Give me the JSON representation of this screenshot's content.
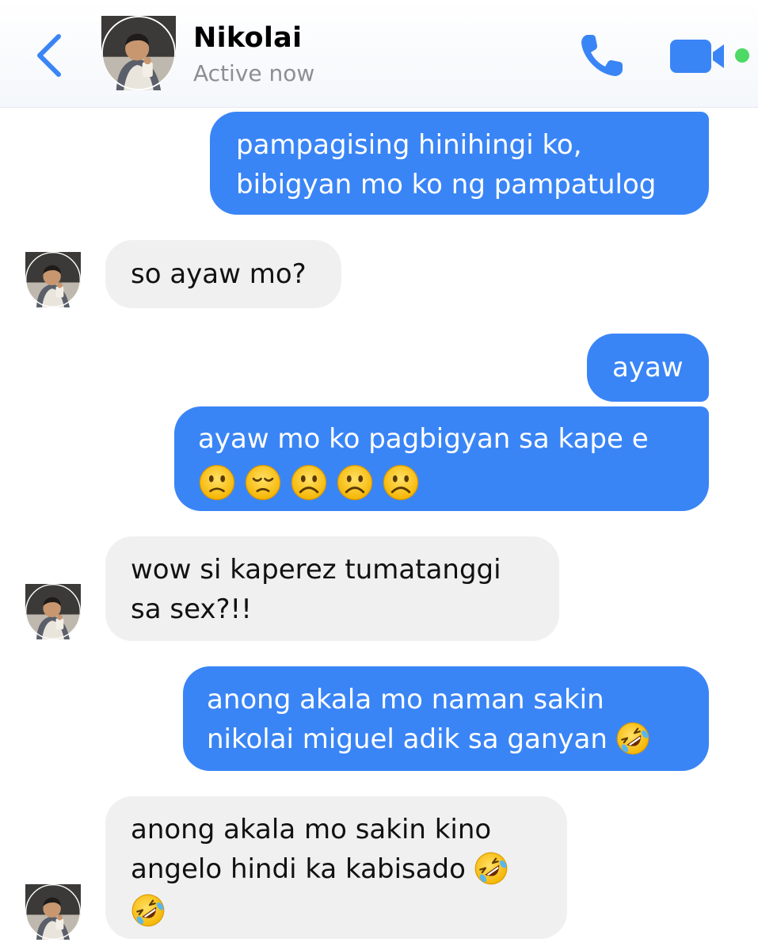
{
  "contact": {
    "name": "Nikolai",
    "status": "Active now"
  },
  "icons": {
    "back": "chevron-left-icon",
    "call": "phone-icon",
    "video": "video-camera-icon",
    "online": "online-dot-icon"
  },
  "colors": {
    "accent": "#3a85f6",
    "incoming_bubble": "#f0f0f0",
    "online_dot": "#4cd964"
  },
  "messages": [
    {
      "from": "me",
      "lines": [
        "pampagising hinihingi ko,",
        "bibigyan mo ko ng pampatulog"
      ]
    },
    {
      "from": "them",
      "lines": [
        "so ayaw mo?"
      ]
    },
    {
      "from": "me",
      "lines": [
        "ayaw"
      ]
    },
    {
      "from": "me",
      "lines": [
        "ayaw mo ko pagbigyan sa kape e"
      ],
      "emojis": [
        "slightly-frowning-face",
        "disappointed-face",
        "frowning-face",
        "frowning-face",
        "frowning-face"
      ]
    },
    {
      "from": "them",
      "lines": [
        "wow si kaperez tumatanggi",
        "sa sex?!!"
      ]
    },
    {
      "from": "me",
      "lines": [
        "anong akala mo naman sakin",
        "nikolai miguel adik sa ganyan"
      ],
      "emojis": [
        "rolling-on-floor-laughing"
      ]
    },
    {
      "from": "them",
      "lines": [
        "anong akala mo sakin kino",
        "angelo hindi ka kabisado"
      ],
      "emojis": [
        "rolling-on-floor-laughing",
        "rolling-on-floor-laughing"
      ]
    }
  ]
}
